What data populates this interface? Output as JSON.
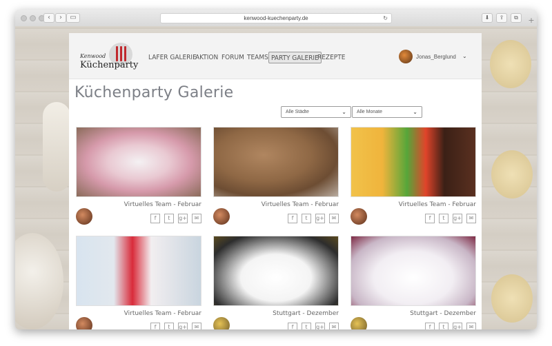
{
  "browser": {
    "url": "kenwood-kuechenparty.de",
    "reload_icon": "↻",
    "back_icon": "‹",
    "forward_icon": "›",
    "sidebar_icon": "▭",
    "download_icon": "⬇",
    "share_icon": "⇪",
    "tabs_icon": "⧉",
    "new_tab_icon": "+"
  },
  "logo": {
    "top": "Kenwood",
    "main": "Küchenparty"
  },
  "nav": {
    "items": [
      "LAFER GALERIE",
      "AKTION",
      "FORUM",
      "TEAMS",
      "PARTY GALERIE",
      "REZEPTE"
    ],
    "active": "PARTY GALERIE"
  },
  "user": {
    "name": "Jonas_Berglund",
    "chevron": "⌄"
  },
  "page": {
    "title": "Küchenparty Galerie"
  },
  "filters": {
    "city": {
      "value": "Alle Städte",
      "chevron": "⌄"
    },
    "month": {
      "value": "Alle Monate",
      "chevron": "⌄"
    }
  },
  "social_labels": [
    "f",
    "t",
    "g+",
    "✉"
  ],
  "gallery": [
    {
      "caption": "Virtuelles Team - Februar"
    },
    {
      "caption": "Virtuelles Team - Februar"
    },
    {
      "caption": "Virtuelles Team - Februar"
    },
    {
      "caption": "Virtuelles Team - Februar"
    },
    {
      "caption": "Stuttgart - Dezember"
    },
    {
      "caption": "Stuttgart - Dezember"
    }
  ],
  "colors": {
    "accent": "#c0282d",
    "title": "#7c7f86"
  }
}
